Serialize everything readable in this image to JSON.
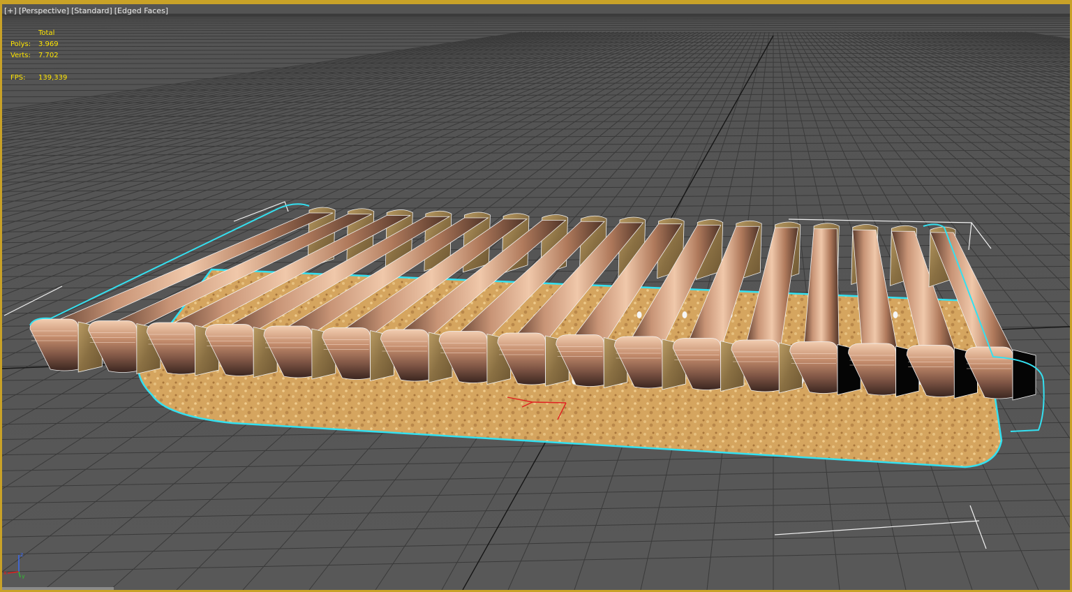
{
  "viewport": {
    "labels": [
      "[+]",
      "[Perspective]",
      "[Standard]",
      "[Edged Faces]"
    ],
    "active_border_color": "#c9a227",
    "background_color": "#555555",
    "grid_color": "#2f2f2f"
  },
  "stats": {
    "header": "Total",
    "polys_label": "Polys:",
    "polys_value": "3.969",
    "verts_label": "Verts:",
    "verts_value": "7.702",
    "fps_label": "FPS:",
    "fps_value": "139,339",
    "text_color": "#ffe600"
  },
  "gizmo": {
    "x_label": "x",
    "y_label": "y",
    "z_label": "z"
  },
  "model": {
    "selection_outline_color": "#34e0f0",
    "slat_count": 17,
    "slat_color_light": "#e6b89a",
    "slat_color_dark": "#6b4a3a",
    "base_color": "#d2a45f"
  }
}
